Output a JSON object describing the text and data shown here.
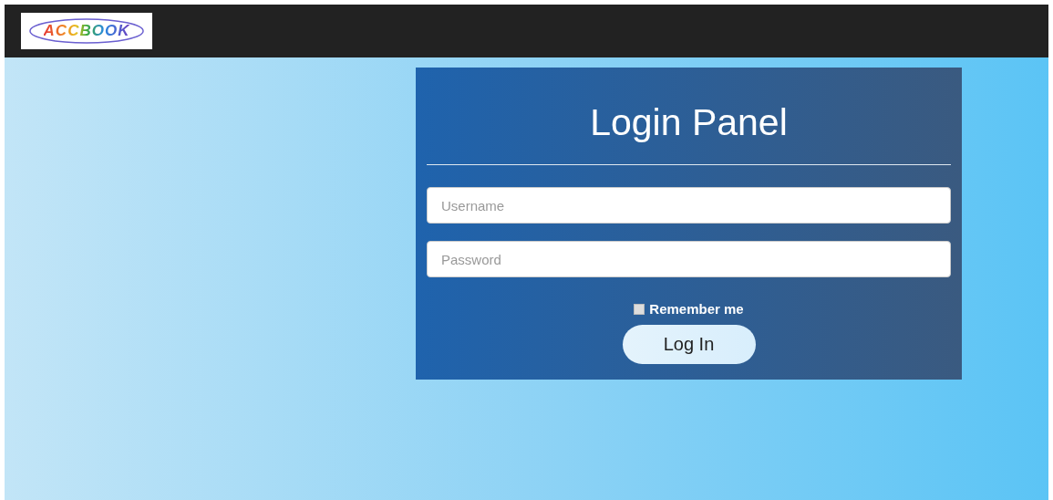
{
  "header": {
    "logo": "ACCBOOK"
  },
  "login_panel": {
    "title": "Login Panel",
    "fields": [
      {
        "placeholder": "Username"
      },
      {
        "placeholder": "Password"
      }
    ],
    "remember": {
      "label": "Remember me",
      "checked": false
    },
    "button": "Log In"
  }
}
